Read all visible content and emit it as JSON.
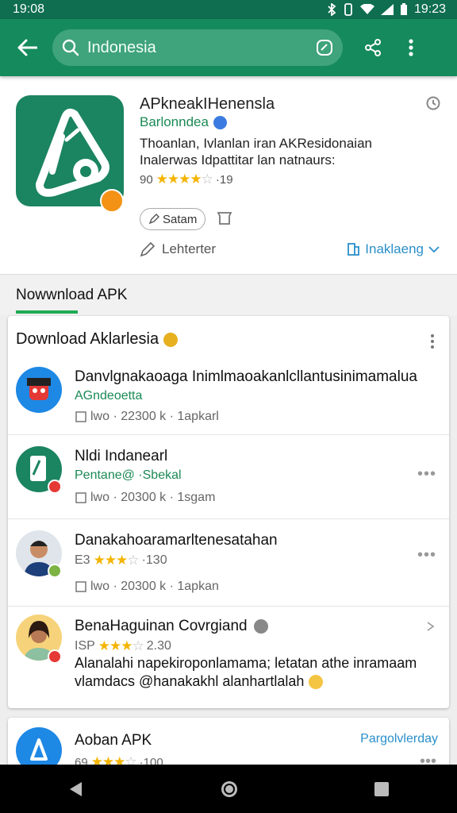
{
  "status": {
    "time_left": "19:08",
    "time_right": "19:23"
  },
  "search": {
    "query": "Indonesia"
  },
  "app": {
    "title": "APkneakIHenensla",
    "developer": "Barlonndea",
    "description_line1": "Thoanlan, Ivlanlan iran AKResidonaian",
    "description_line2": "Inalerwas Idpattitar lan natnaurs:",
    "rating_prefix": "90",
    "rating_stars": 4,
    "rating_suffix": "·19",
    "chip_label": "Satam",
    "action_left": "Lehterter",
    "install_label": "Inaklaeng"
  },
  "tabs": {
    "active_label": "Nowwnload APK"
  },
  "card": {
    "title": "Download Aklarlesia",
    "items": [
      {
        "title": "Danvlgnakaoaga Inimlmaoakanlcllantusinimamalua",
        "subtitle": "AGndeoetta",
        "meta": "lwo · 22300 k · 1apkarl"
      },
      {
        "title": "Nldi Indanearl",
        "subtitle": "Pentane@ ·Sbekal",
        "meta": "lwo · 20300 k · 1sgam"
      },
      {
        "title": "Danakahoaramarltenesatahan",
        "rating_prefix": "E3",
        "rating_stars": 3,
        "rating_suffix": "·130",
        "meta": "lwo · 20300 k · 1apkan"
      },
      {
        "title": "BenaHaguinan Covrgiand",
        "rating_prefix": "ISP",
        "rating_stars": 3,
        "rating_suffix": "2.30",
        "desc_line1": "Alanalahi napekiroponlamama; letatan athe inramaam",
        "desc_line2": "vlamdacs @hanakakhl alanhartlalah"
      }
    ]
  },
  "card2": {
    "title": "Aoban APK",
    "link": "Pargolvlerday",
    "rating_prefix": "69",
    "rating_stars": 3,
    "rating_suffix": "·100"
  },
  "icons": {
    "back": "arrow-left-icon",
    "search": "search-icon",
    "share": "share-icon",
    "more": "more-vert-icon"
  },
  "colors": {
    "appbar": "#158a5d",
    "accent_green": "#1faa55",
    "link_blue": "#2a8fca",
    "star": "#f4b400"
  }
}
